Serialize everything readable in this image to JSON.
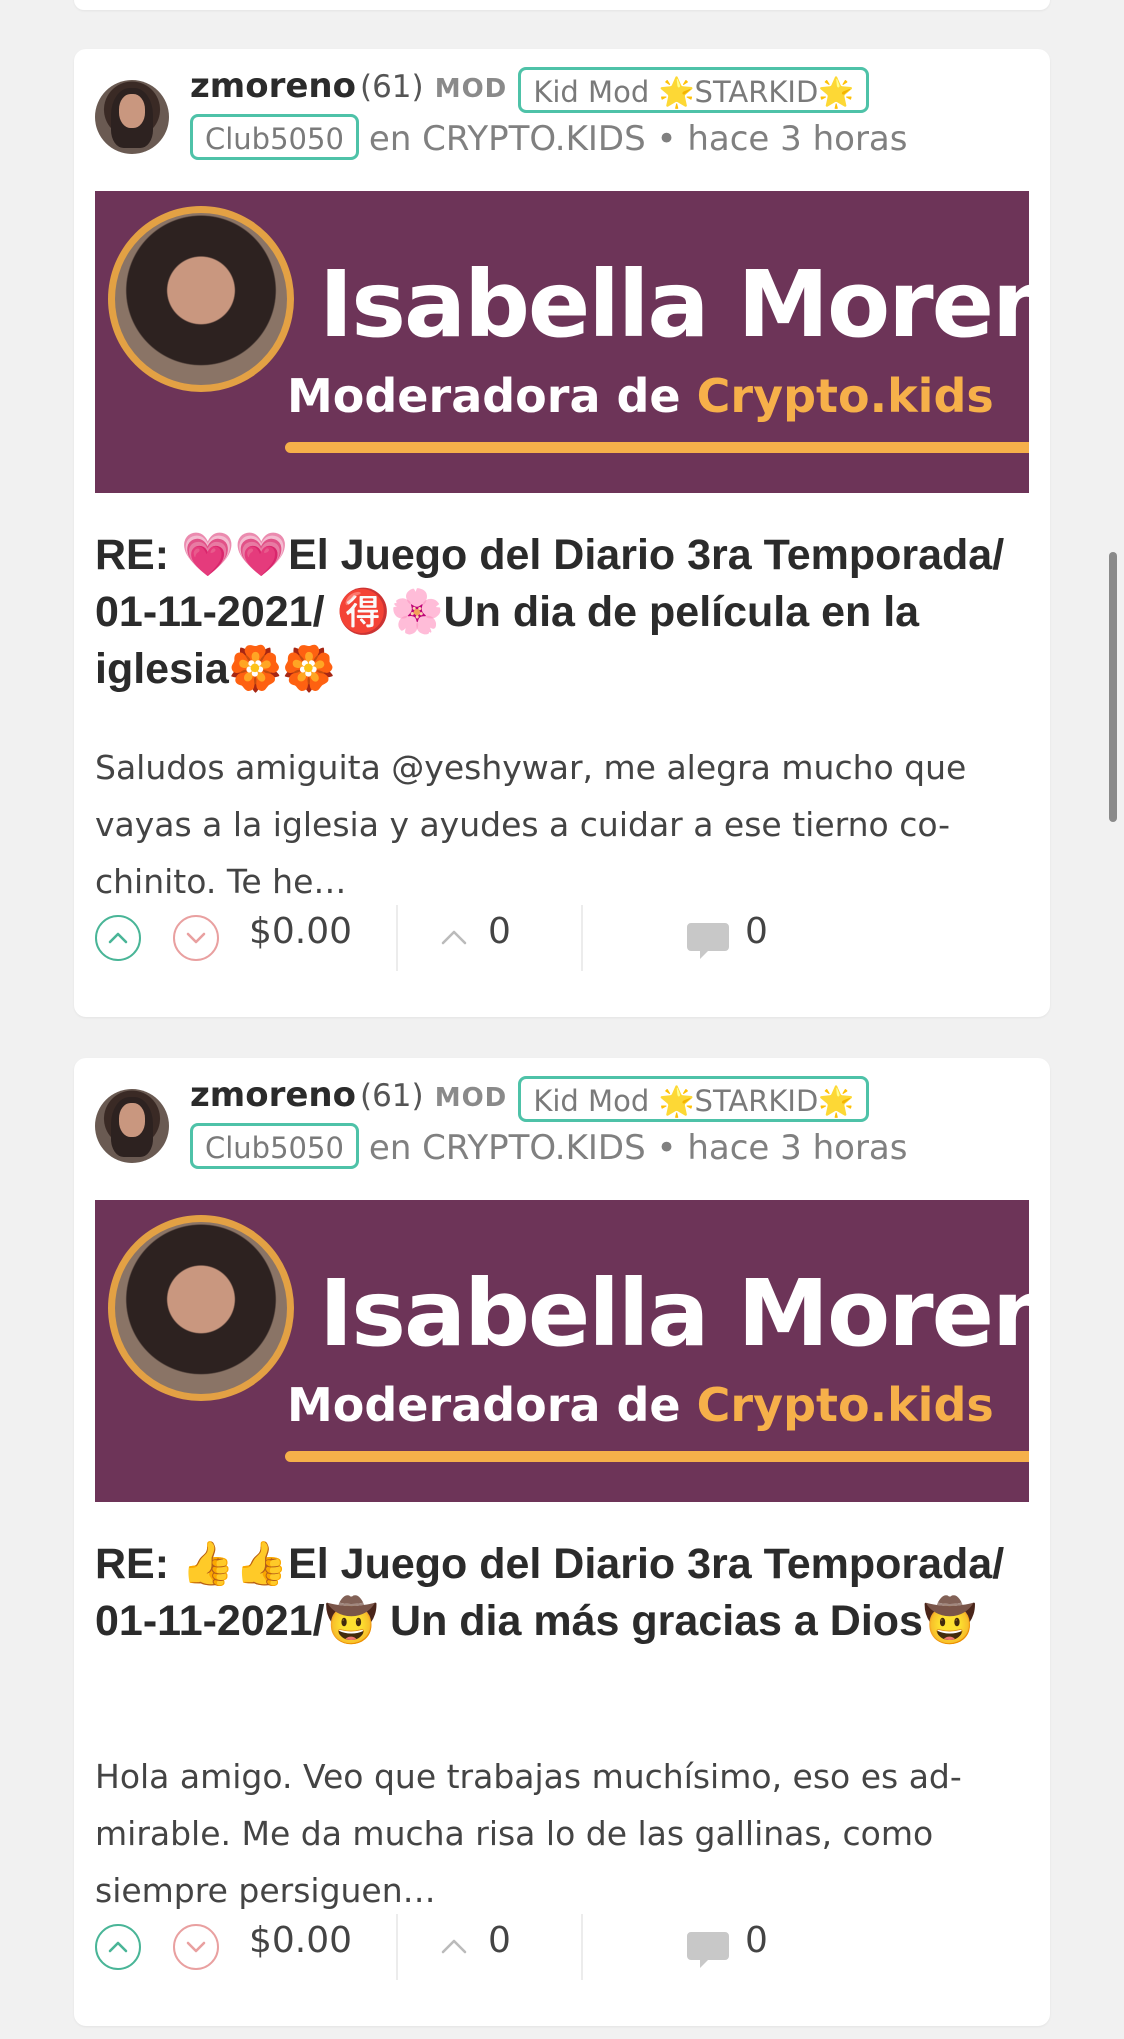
{
  "posts": [
    {
      "author": "zmoreno",
      "reputation": "(61)",
      "mod_tag": "MOD",
      "badge_title": "Kid Mod 🌟STARKID🌟",
      "badge_club": "Club5050",
      "community_line": "en CRYPTO.KIDS • hace 3 horas",
      "banner_name": "Isabella Moreno",
      "banner_role": "Moderadora de ",
      "banner_brand": "Crypto.kids",
      "title": "RE: 💗💗El Juego del Diario 3ra Temporada/ 01-11-2021/ 🉐🌸Un dia de película en la iglesia🏵️🏵️",
      "excerpt": "Saludos amiguita @yeshywar, me alegra mucho que vayas a la iglesia y ayudes a cuidar a ese tierno co-chinito. Te he…",
      "payout": "$0.00",
      "reblogs": "0",
      "comments": "0"
    },
    {
      "author": "zmoreno",
      "reputation": "(61)",
      "mod_tag": "MOD",
      "badge_title": "Kid Mod 🌟STARKID🌟",
      "badge_club": "Club5050",
      "community_line": "en CRYPTO.KIDS • hace 3 horas",
      "banner_name": "Isabella Moreno",
      "banner_role": "Moderadora de ",
      "banner_brand": "Crypto.kids",
      "title": "RE: 👍👍El Juego del Diario 3ra Temporada/ 01-11-2021/🤠 Un dia más gracias a Dios🤠",
      "excerpt": "Hola amigo. Veo que trabajas muchísimo, eso es ad-mirable. Me da mucha risa lo de las gallinas, como siempre persiguen…",
      "payout": "$0.00",
      "reblogs": "0",
      "comments": "0"
    }
  ],
  "colors": {
    "upvote": "#49b597",
    "downvote": "#e9a0a0",
    "badge_border": "#4ec2a8",
    "banner_bg": "#6d3458",
    "banner_accent": "#f6b04a"
  },
  "icons": {
    "upvote": "chevron-up-icon",
    "downvote": "chevron-down-icon",
    "reblog": "caret-up-icon",
    "comment": "speech-bubble-icon"
  }
}
